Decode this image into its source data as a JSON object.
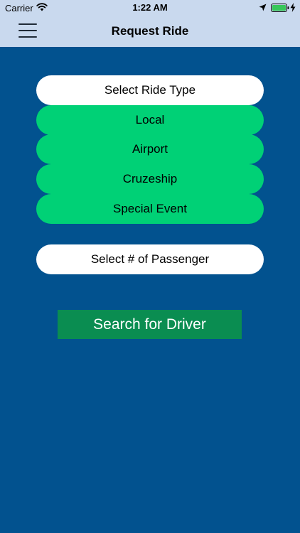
{
  "status_bar": {
    "carrier": "Carrier",
    "time": "1:22 AM",
    "icons": [
      "wifi-icon",
      "location-arrow-icon",
      "battery-icon",
      "charging-bolt-icon"
    ]
  },
  "navbar": {
    "title": "Request Ride",
    "menu_icon": "hamburger-menu-icon"
  },
  "ride_type": {
    "header": "Select Ride Type",
    "options": [
      "Local",
      "Airport",
      "Cruzeship",
      "Special Event"
    ]
  },
  "passenger": {
    "label": "Select # of Passenger"
  },
  "search_button": {
    "label": "Search for Driver"
  },
  "colors": {
    "background": "#02528f",
    "topbar": "#c9d9ee",
    "option_green": "#00d176",
    "search_green": "#0a8d51",
    "battery_green": "#36c759"
  }
}
